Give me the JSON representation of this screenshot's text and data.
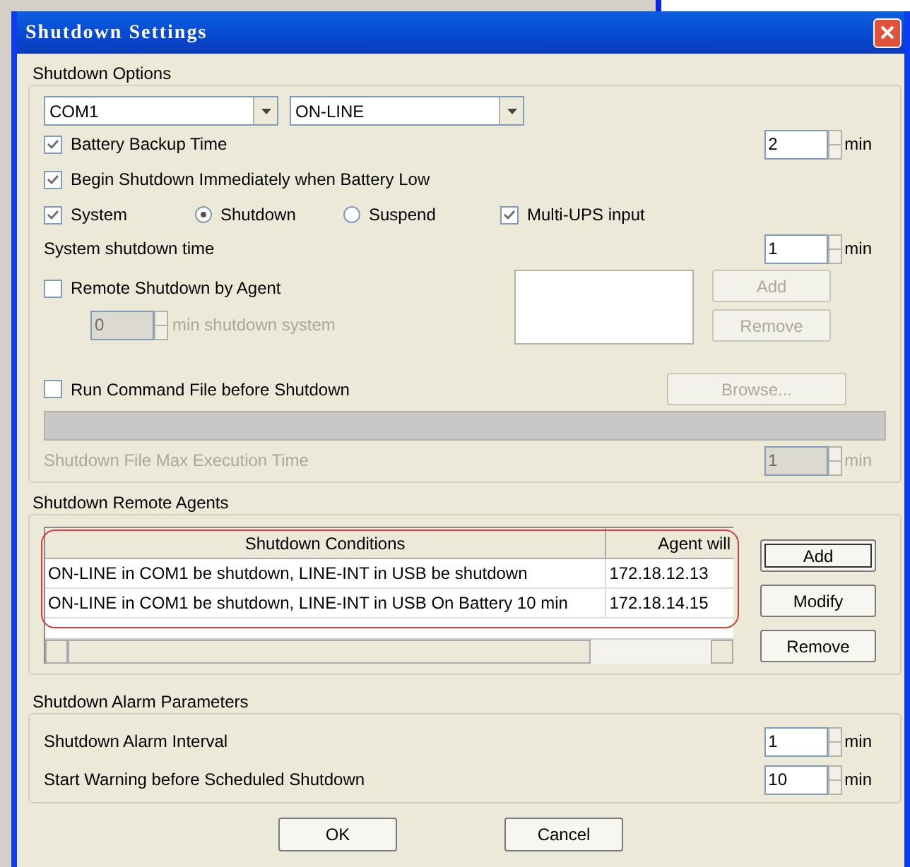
{
  "window": {
    "title": "Shutdown Settings"
  },
  "shutdown_options": {
    "label": "Shutdown Options",
    "port_dropdown": {
      "value": "COM1"
    },
    "ups_dropdown": {
      "value": "ON-LINE"
    },
    "battery_backup": {
      "label": "Battery Backup Time",
      "checked": true,
      "value": "2",
      "unit": "min"
    },
    "begin_shutdown": {
      "label": "Begin Shutdown Immediately when Battery Low",
      "checked": true
    },
    "system": {
      "label": "System",
      "checked": true
    },
    "mode_radios": [
      {
        "label": "Shutdown",
        "selected": true
      },
      {
        "label": "Suspend",
        "selected": false
      }
    ],
    "multi_ups": {
      "label": "Multi-UPS input",
      "checked": true
    },
    "system_shutdown_time": {
      "label": "System shutdown time",
      "value": "1",
      "unit": "min"
    },
    "remote_shutdown": {
      "label": "Remote Shutdown by Agent",
      "checked": false,
      "delay_value": "0",
      "delay_label": "min shutdown system",
      "disabled": true
    },
    "agent_buttons": [
      {
        "label": "Add",
        "disabled": true
      },
      {
        "label": "Remove",
        "disabled": true
      }
    ],
    "run_command": {
      "label": "Run Command File before Shutdown",
      "checked": false,
      "browse_label": "Browse...",
      "disabled": true
    },
    "max_execution": {
      "label": "Shutdown File Max Execution Time",
      "value": "1",
      "unit": "min",
      "disabled": true
    }
  },
  "remote_agents": {
    "label": "Shutdown Remote Agents",
    "table": {
      "columns": [
        "Shutdown Conditions",
        "Agent will"
      ],
      "rows": [
        [
          "ON-LINE in COM1 be shutdown, LINE-INT in USB be shutdown",
          "172.18.12.13"
        ],
        [
          "ON-LINE in COM1 be shutdown, LINE-INT in USB On Battery 10 min",
          "172.18.14.15"
        ]
      ]
    },
    "buttons": [
      {
        "label": "Add",
        "default": true
      },
      {
        "label": "Modify",
        "default": false
      },
      {
        "label": "Remove",
        "default": false
      }
    ]
  },
  "alarm_parameters": {
    "label": "Shutdown Alarm Parameters",
    "rows": [
      {
        "label": "Shutdown Alarm Interval",
        "value": "1",
        "unit": "min"
      },
      {
        "label": "Start Warning before Scheduled Shutdown",
        "value": "10",
        "unit": "min"
      }
    ]
  },
  "dialog_buttons": [
    {
      "label": "OK"
    },
    {
      "label": "Cancel"
    }
  ]
}
